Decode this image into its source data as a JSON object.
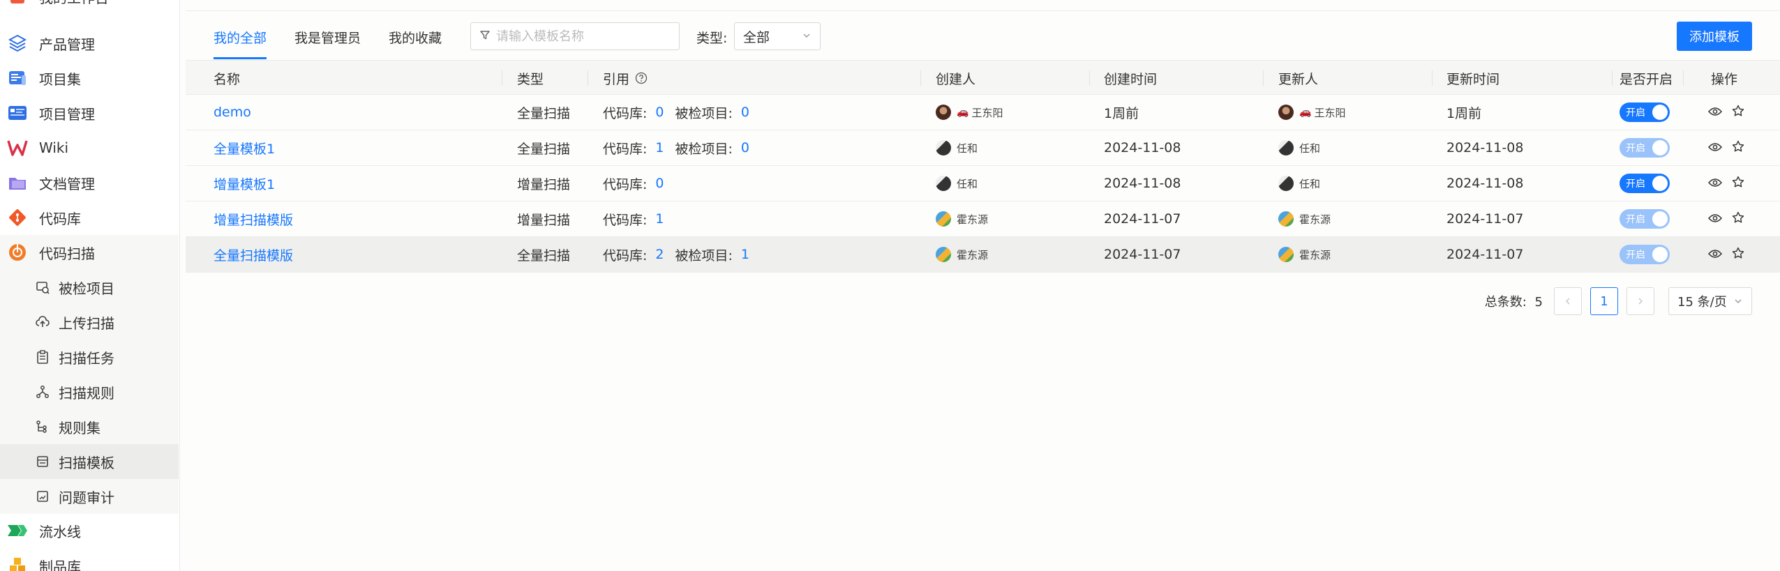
{
  "sidebar": {
    "top_partial": "我的工作台",
    "items": [
      {
        "label": "产品管理",
        "icon": "layers-icon"
      },
      {
        "label": "项目集",
        "icon": "project-set-icon"
      },
      {
        "label": "项目管理",
        "icon": "project-icon"
      },
      {
        "label": "Wiki",
        "icon": "wiki-icon"
      },
      {
        "label": "文档管理",
        "icon": "folder-icon"
      },
      {
        "label": "代码库",
        "icon": "git-icon"
      },
      {
        "label": "代码扫描",
        "icon": "scan-icon"
      }
    ],
    "sub_items": [
      {
        "label": "被检项目",
        "icon": "checked-project-icon"
      },
      {
        "label": "上传扫描",
        "icon": "upload-cloud-icon"
      },
      {
        "label": "扫描任务",
        "icon": "task-clipboard-icon"
      },
      {
        "label": "扫描规则",
        "icon": "rule-nodes-icon"
      },
      {
        "label": "规则集",
        "icon": "rule-set-icon"
      },
      {
        "label": "扫描模板",
        "icon": "template-icon"
      },
      {
        "label": "问题审计",
        "icon": "audit-icon"
      }
    ],
    "bottom_items": [
      {
        "label": "流水线",
        "icon": "pipeline-icon"
      },
      {
        "label": "制品库",
        "icon": "artifact-icon"
      }
    ]
  },
  "tabs": [
    "我的全部",
    "我是管理员",
    "我的收藏"
  ],
  "search": {
    "placeholder": "请输入模板名称",
    "value": ""
  },
  "type_filter": {
    "label": "类型:",
    "value": "全部"
  },
  "add_button": "添加模板",
  "table": {
    "headers": {
      "name": "名称",
      "type": "类型",
      "ref": "引用",
      "creator": "创建人",
      "created": "创建时间",
      "updater": "更新人",
      "updated": "更新时间",
      "enabled": "是否开启",
      "actions": "操作"
    },
    "ref_labels": {
      "repo": "代码库:",
      "project": "被检项目:"
    },
    "toggle_label": "开启",
    "rows": [
      {
        "name": "demo",
        "type": "全量扫描",
        "repo": "0",
        "project": "0",
        "creator": "王东阳",
        "created": "1周前",
        "updater": "王东阳",
        "updated": "1周前",
        "enabled": true
      },
      {
        "name": "全量模板1",
        "type": "全量扫描",
        "repo": "1",
        "project": "0",
        "creator": "任和",
        "created": "2024-11-08",
        "updater": "任和",
        "updated": "2024-11-08",
        "enabled": false
      },
      {
        "name": "增量模板1",
        "type": "增量扫描",
        "repo": "0",
        "project": "",
        "creator": "任和",
        "created": "2024-11-08",
        "updater": "任和",
        "updated": "2024-11-08",
        "enabled": true
      },
      {
        "name": "增量扫描模版",
        "type": "增量扫描",
        "repo": "1",
        "project": "",
        "creator": "霍东源",
        "created": "2024-11-07",
        "updater": "霍东源",
        "updated": "2024-11-07",
        "enabled": false
      },
      {
        "name": "全量扫描模版",
        "type": "全量扫描",
        "repo": "2",
        "project": "1",
        "creator": "霍东源",
        "created": "2024-11-07",
        "updater": "霍东源",
        "updated": "2024-11-07",
        "enabled": false
      }
    ]
  },
  "pagination": {
    "total_label": "总条数:",
    "total": "5",
    "current": "1",
    "page_size": "15 条/页"
  },
  "colors": {
    "accent": "#1677ff",
    "accent_dim": "#99c3fa"
  }
}
